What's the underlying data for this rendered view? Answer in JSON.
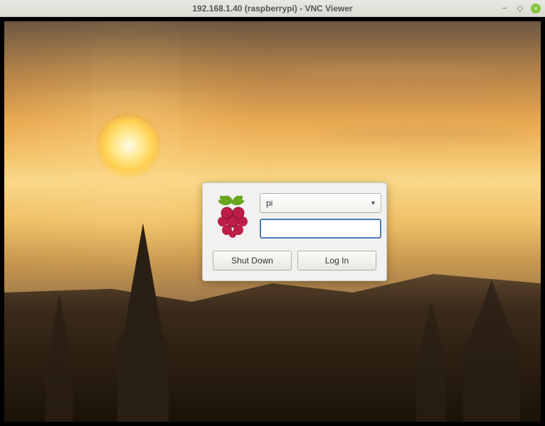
{
  "window": {
    "title": "192.168.1.40 (raspberrypi) - VNC Viewer"
  },
  "login": {
    "username": "pi",
    "password_value": "",
    "shutdown_label": "Shut Down",
    "login_label": "Log In"
  }
}
